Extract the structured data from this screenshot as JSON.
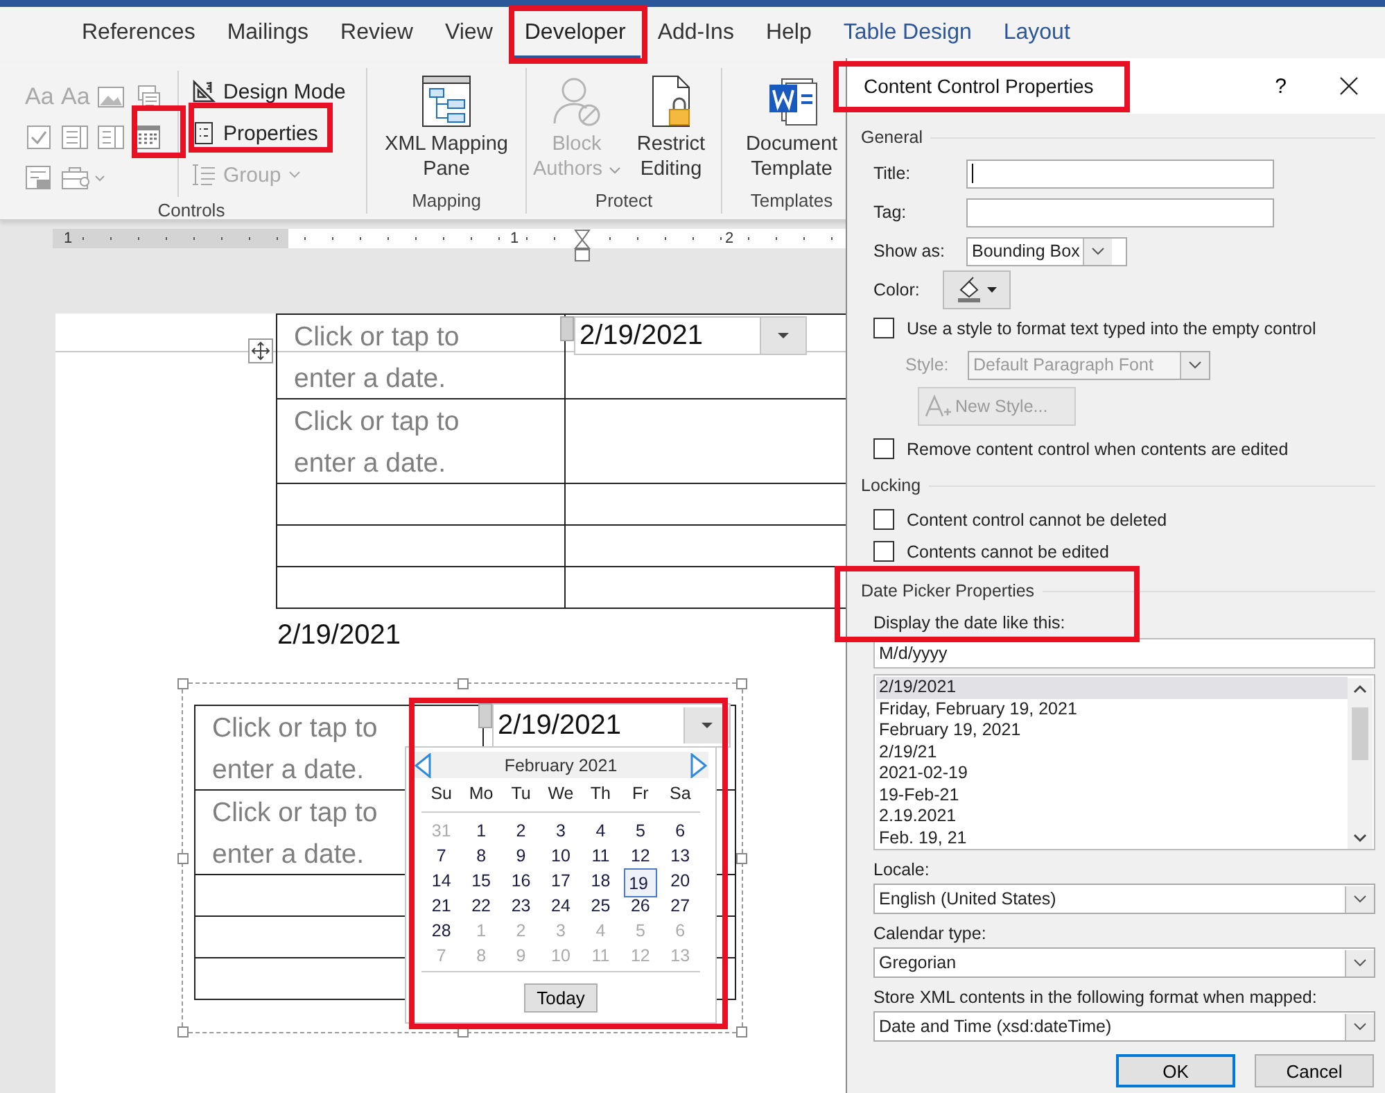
{
  "ribbon_tabs": [
    {
      "label": "References",
      "kind": "standard",
      "selected": false
    },
    {
      "label": "Mailings",
      "kind": "standard",
      "selected": false
    },
    {
      "label": "Review",
      "kind": "standard",
      "selected": false
    },
    {
      "label": "View",
      "kind": "standard",
      "selected": false
    },
    {
      "label": "Developer",
      "kind": "standard",
      "selected": true
    },
    {
      "label": "Add-Ins",
      "kind": "standard",
      "selected": false
    },
    {
      "label": "Help",
      "kind": "standard",
      "selected": false
    },
    {
      "label": "Table Design",
      "kind": "contextual",
      "selected": false
    },
    {
      "label": "Layout",
      "kind": "contextual",
      "selected": false
    }
  ],
  "ribbon": {
    "controls": {
      "label": "Controls",
      "text_icons": [
        "Aa",
        "Aa"
      ],
      "design_mode": "Design Mode",
      "properties": "Properties",
      "group": {
        "label": "Group",
        "disabled": true
      }
    },
    "mapping": {
      "label": "Mapping",
      "xml_mapping_pane": "XML Mapping Pane"
    },
    "protect": {
      "label": "Protect",
      "block_authors": {
        "label": "Block Authors",
        "disabled": true
      },
      "restrict_editing": "Restrict Editing"
    },
    "templates": {
      "label": "Templates",
      "document_template": "Document Template"
    }
  },
  "ruler": {
    "labels": [
      "1",
      "1",
      "2"
    ]
  },
  "document": {
    "table_1": {
      "rows": [
        {
          "cell_1": "Click or tap to enter a date.",
          "date_value": "2/19/2021"
        },
        {
          "cell_1": "Click or tap to enter a date."
        },
        {},
        {},
        {}
      ]
    },
    "date_text": "2/19/2021",
    "table_2": {
      "rows": [
        {
          "cell_1": "Click or tap to enter a date.",
          "date_value": "2/19/2021"
        },
        {
          "cell_1": "Click or tap to enter a date."
        },
        {},
        {},
        {}
      ]
    },
    "calendar": {
      "month": "February 2021",
      "weekdays": [
        "Su",
        "Mo",
        "Tu",
        "We",
        "Th",
        "Fr",
        "Sa"
      ],
      "weeks": [
        [
          {
            "label": "31",
            "in_month": false,
            "selected": false
          },
          {
            "label": "1",
            "in_month": true,
            "selected": false
          },
          {
            "label": "2",
            "in_month": true,
            "selected": false
          },
          {
            "label": "3",
            "in_month": true,
            "selected": false
          },
          {
            "label": "4",
            "in_month": true,
            "selected": false
          },
          {
            "label": "5",
            "in_month": true,
            "selected": false
          },
          {
            "label": "6",
            "in_month": true,
            "selected": false
          }
        ],
        [
          {
            "label": "7",
            "in_month": true,
            "selected": false
          },
          {
            "label": "8",
            "in_month": true,
            "selected": false
          },
          {
            "label": "9",
            "in_month": true,
            "selected": false
          },
          {
            "label": "10",
            "in_month": true,
            "selected": false
          },
          {
            "label": "11",
            "in_month": true,
            "selected": false
          },
          {
            "label": "12",
            "in_month": true,
            "selected": false
          },
          {
            "label": "13",
            "in_month": true,
            "selected": false
          }
        ],
        [
          {
            "label": "14",
            "in_month": true,
            "selected": false
          },
          {
            "label": "15",
            "in_month": true,
            "selected": false
          },
          {
            "label": "16",
            "in_month": true,
            "selected": false
          },
          {
            "label": "17",
            "in_month": true,
            "selected": false
          },
          {
            "label": "18",
            "in_month": true,
            "selected": false
          },
          {
            "label": "19",
            "in_month": true,
            "selected": true
          },
          {
            "label": "20",
            "in_month": true,
            "selected": false
          }
        ],
        [
          {
            "label": "21",
            "in_month": true,
            "selected": false
          },
          {
            "label": "22",
            "in_month": true,
            "selected": false
          },
          {
            "label": "23",
            "in_month": true,
            "selected": false
          },
          {
            "label": "24",
            "in_month": true,
            "selected": false
          },
          {
            "label": "25",
            "in_month": true,
            "selected": false
          },
          {
            "label": "26",
            "in_month": true,
            "selected": false
          },
          {
            "label": "27",
            "in_month": true,
            "selected": false
          }
        ],
        [
          {
            "label": "28",
            "in_month": true,
            "selected": false
          },
          {
            "label": "1",
            "in_month": false,
            "selected": false
          },
          {
            "label": "2",
            "in_month": false,
            "selected": false
          },
          {
            "label": "3",
            "in_month": false,
            "selected": false
          },
          {
            "label": "4",
            "in_month": false,
            "selected": false
          },
          {
            "label": "5",
            "in_month": false,
            "selected": false
          },
          {
            "label": "6",
            "in_month": false,
            "selected": false
          }
        ],
        [
          {
            "label": "7",
            "in_month": false,
            "selected": false
          },
          {
            "label": "8",
            "in_month": false,
            "selected": false
          },
          {
            "label": "9",
            "in_month": false,
            "selected": false
          },
          {
            "label": "10",
            "in_month": false,
            "selected": false
          },
          {
            "label": "11",
            "in_month": false,
            "selected": false
          },
          {
            "label": "12",
            "in_month": false,
            "selected": false
          },
          {
            "label": "13",
            "in_month": false,
            "selected": false
          }
        ]
      ],
      "today_button": "Today"
    }
  },
  "dialog": {
    "title": "Content Control Properties",
    "help": "?",
    "general": {
      "heading": "General",
      "title_label": "Title:",
      "tag_label": "Tag:",
      "show_as_label": "Show as:",
      "show_as_value": "Bounding Box",
      "color_label": "Color:",
      "use_style": {
        "label": "Use a style to format text typed into the empty control",
        "checked": false
      },
      "style": {
        "label": "Style:",
        "value": "Default Paragraph Font",
        "disabled": true
      },
      "new_style": {
        "label": "New Style...",
        "disabled": true
      },
      "remove": {
        "label": "Remove content control when contents are edited",
        "checked": false
      }
    },
    "locking": {
      "heading": "Locking",
      "options": [
        {
          "label": "Content control cannot be deleted",
          "checked": false
        },
        {
          "label": "Contents cannot be edited",
          "checked": false
        }
      ]
    },
    "date_picker": {
      "heading": "Date Picker Properties",
      "display_label": "Display the date like this:",
      "format_value": "M/d/yyyy",
      "formats": [
        {
          "label": "2/19/2021",
          "selected": true
        },
        {
          "label": "Friday, February 19, 2021",
          "selected": false
        },
        {
          "label": "February 19, 2021",
          "selected": false
        },
        {
          "label": "2/19/21",
          "selected": false
        },
        {
          "label": "2021-02-19",
          "selected": false
        },
        {
          "label": "19-Feb-21",
          "selected": false
        },
        {
          "label": "2.19.2021",
          "selected": false
        },
        {
          "label": "Feb. 19, 21",
          "selected": false
        }
      ],
      "locale_label": "Locale:",
      "locale_value": "English (United States)",
      "calendar_label": "Calendar type:",
      "calendar_value": "Gregorian",
      "store_label": "Store XML contents in the following format when mapped:",
      "store_value": "Date and Time (xsd:dateTime)"
    },
    "buttons": [
      {
        "label": "OK",
        "default": true
      },
      {
        "label": "Cancel",
        "default": false
      }
    ]
  }
}
